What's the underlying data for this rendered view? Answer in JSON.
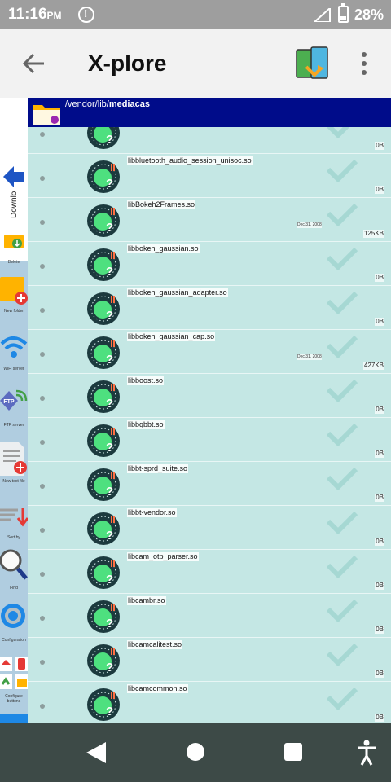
{
  "status_bar": {
    "time": "11:16",
    "ampm": "PM",
    "battery": "28%"
  },
  "toolbar": {
    "title": "X-plore",
    "back_icon": "back-arrow-icon",
    "menu_icon": "more-vert-icon"
  },
  "path": {
    "prefix": "/vendor/lib/",
    "current": "mediacas"
  },
  "side_panel": {
    "downloads_label": "Downlo",
    "items": [
      {
        "label": "Delete",
        "icon": "delete-icon"
      },
      {
        "label": "New folder",
        "icon": "new-folder-icon"
      },
      {
        "label": "WiFi server",
        "icon": "wifi-icon"
      },
      {
        "label": "FTP server",
        "icon": "ftp-icon"
      },
      {
        "label": "New text file",
        "icon": "new-text-file-icon"
      },
      {
        "label": "Sort by",
        "icon": "sort-icon"
      },
      {
        "label": "Find",
        "icon": "search-icon"
      },
      {
        "label": "Configuration",
        "icon": "gear-icon"
      },
      {
        "label": "Configure buttons",
        "icon": "configure-buttons-icon"
      }
    ]
  },
  "files": [
    {
      "name": "",
      "date": "",
      "size": "0B"
    },
    {
      "name": "libbluetooth_audio_session_unisoc.so",
      "date": "",
      "size": "0B"
    },
    {
      "name": "libBokeh2Frames.so",
      "date": "Dec 31, 2008",
      "size": "125KB"
    },
    {
      "name": "libbokeh_gaussian.so",
      "date": "",
      "size": "0B"
    },
    {
      "name": "libbokeh_gaussian_adapter.so",
      "date": "",
      "size": "0B"
    },
    {
      "name": "libbokeh_gaussian_cap.so",
      "date": "Dec 31, 2008",
      "size": "427KB"
    },
    {
      "name": "libboost.so",
      "date": "",
      "size": "0B"
    },
    {
      "name": "libbqbbt.so",
      "date": "",
      "size": "0B"
    },
    {
      "name": "libbt-sprd_suite.so",
      "date": "",
      "size": "0B"
    },
    {
      "name": "libbt-vendor.so",
      "date": "",
      "size": "0B"
    },
    {
      "name": "libcam_otp_parser.so",
      "date": "",
      "size": "0B"
    },
    {
      "name": "libcambr.so",
      "date": "",
      "size": "0B"
    },
    {
      "name": "libcamcalitest.so",
      "date": "",
      "size": "0B"
    },
    {
      "name": "libcamcommon.so",
      "date": "",
      "size": "0B"
    }
  ],
  "navbar": {
    "back_icon": "nav-back-icon",
    "home_icon": "nav-home-icon",
    "recents_icon": "nav-recents-icon",
    "accessibility_icon": "accessibility-icon"
  }
}
